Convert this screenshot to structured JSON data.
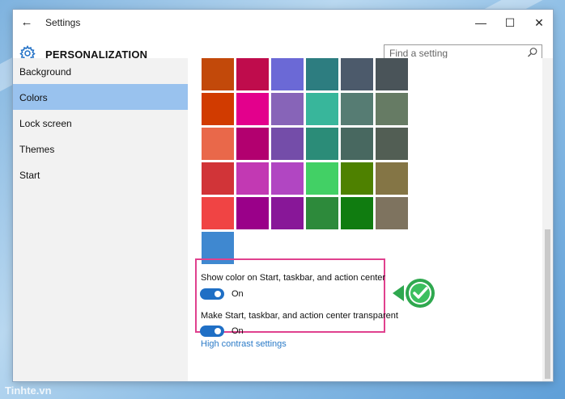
{
  "window": {
    "title": "Settings",
    "back_icon": "back-arrow-icon",
    "minimize_icon": "minimize-icon",
    "maximize_icon": "maximize-icon",
    "close_icon": "close-icon"
  },
  "header": {
    "icon": "gear-icon",
    "title": "PERSONALIZATION",
    "search_placeholder": "Find a setting",
    "search_icon": "search-icon"
  },
  "sidebar": {
    "items": [
      {
        "label": "Background",
        "active": false
      },
      {
        "label": "Colors",
        "active": true
      },
      {
        "label": "Lock screen",
        "active": false
      },
      {
        "label": "Themes",
        "active": false
      },
      {
        "label": "Start",
        "active": false
      }
    ]
  },
  "colors": {
    "swatches": [
      "#c2490a",
      "#bf0c4c",
      "#6b69d6",
      "#2d7d80",
      "#4c5a6b",
      "#4a5459",
      "#d13b00",
      "#e3008c",
      "#8764b8",
      "#38b69b",
      "#567c73",
      "#667b64",
      "#e9684a",
      "#b2006f",
      "#744da9",
      "#2b8c78",
      "#486860",
      "#525e54",
      "#d13438",
      "#c239b3",
      "#b146c2",
      "#42d065",
      "#4e8100",
      "#847545",
      "#f04444",
      "#9a0089",
      "#881798",
      "#2d8a3b",
      "#107c10",
      "#7e735f",
      "#3f88d0"
    ]
  },
  "options": {
    "show_color_label": "Show color on Start, taskbar, and action center",
    "show_color_state": "On",
    "transparent_label": "Make Start, taskbar, and action center transparent",
    "transparent_state": "On",
    "high_contrast_link": "High contrast settings"
  },
  "annotation": {
    "highlight_color": "#e0418e",
    "badge_icon": "green-checkmark-icon"
  },
  "watermark": "Tinhte.vn"
}
